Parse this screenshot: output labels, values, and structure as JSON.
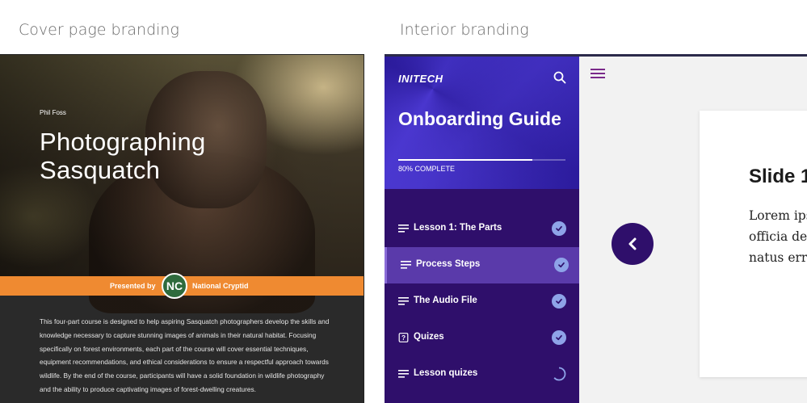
{
  "labels": {
    "cover": "Cover page branding",
    "interior": "Interior branding"
  },
  "cover": {
    "author": "Phil Foss",
    "title": "Photographing Sasquatch",
    "presented_by": "Presented by",
    "logo_text": "NC",
    "partner": "National Cryptid",
    "description": "This four-part course is designed to help aspiring Sasquatch photographers develop the skills and knowledge necessary to capture stunning images of animals in their natural habitat. Focusing specifically on forest environments, each part of the course will cover essential techniques, equipment recommendations, and ethical considerations to ensure a respectful approach towards wildlife. By the end of the course, participants will have a solid foundation in wildlife photography and the ability to produce captivating images of forest-dwelling creatures.",
    "accent_color": "#ef8a31"
  },
  "interior": {
    "brand": "INITECH",
    "course_title": "Onboarding Guide",
    "progress_percent": 80,
    "progress_text": "80% COMPLETE",
    "lessons": [
      {
        "label": "Lesson 1: The Parts",
        "icon": "list-icon",
        "status": "complete"
      },
      {
        "label": "Process Steps",
        "icon": "list-icon",
        "status": "complete",
        "active": true
      },
      {
        "label": "The Audio File",
        "icon": "list-icon",
        "status": "complete"
      },
      {
        "label": "Quizes",
        "icon": "quiz-icon",
        "status": "complete"
      },
      {
        "label": "Lesson quizes",
        "icon": "list-icon",
        "status": "in-progress"
      }
    ],
    "slide": {
      "title": "Slide 1",
      "body_lines": [
        "Lorem ipsum",
        "officia deserunt",
        "natus error"
      ]
    },
    "colors": {
      "sidebar": "#2f0f6b",
      "active_item": "#5a3aaa",
      "check": "#8ea3e8"
    }
  }
}
